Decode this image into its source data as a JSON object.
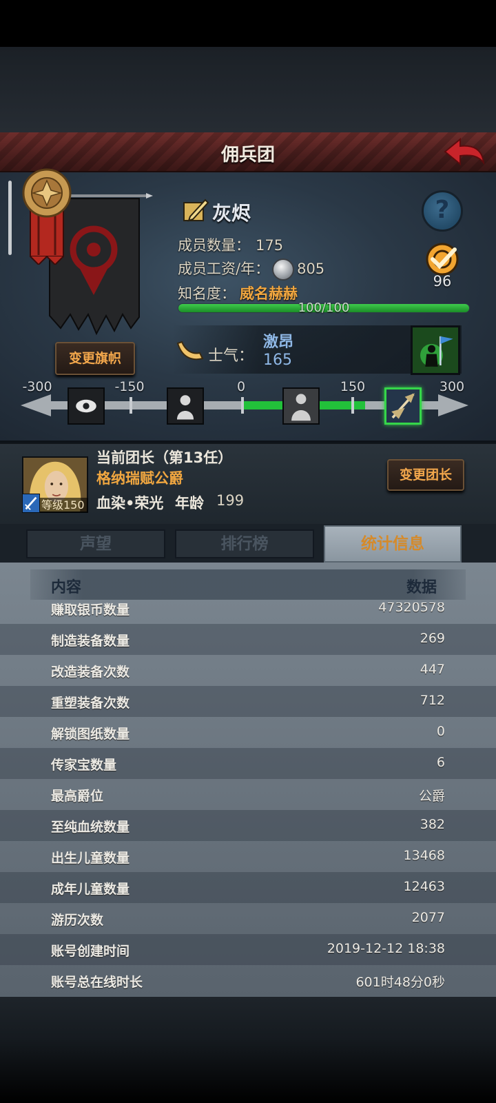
{
  "header": {
    "title": "佣兵团"
  },
  "guild": {
    "name": "灰烬",
    "members_label": "成员数量：",
    "members_value": "175",
    "wage_label": "成员工资/年：",
    "wage_value": "805",
    "fame_label": "知名度：",
    "fame_value": "威名赫赫",
    "fame_progress_text": "100/100",
    "fame_progress": 1.0,
    "achievement_count": "96",
    "change_flag_label": "变更旗帜"
  },
  "morale": {
    "label": "士气：",
    "state": "激昂",
    "value": "165",
    "scale_ticks": [
      "-300",
      "-150",
      "0",
      "150",
      "300"
    ]
  },
  "leader": {
    "title": "当前团长（第13任）",
    "name": "格纳瑞赋公爵",
    "trait": "血染•荣光",
    "age_label": "年龄",
    "age": "199",
    "level_text": "等级150",
    "change_leader_label": "变更团长"
  },
  "tabs": [
    {
      "label": "声望"
    },
    {
      "label": "排行榜"
    },
    {
      "label": "统计信息"
    }
  ],
  "stats": {
    "header_left": "内容",
    "header_right": "数据",
    "rows": [
      {
        "key": "赚取银币数量",
        "value": "47320578"
      },
      {
        "key": "制造装备数量",
        "value": "269"
      },
      {
        "key": "改造装备次数",
        "value": "447"
      },
      {
        "key": "重塑装备次数",
        "value": "712"
      },
      {
        "key": "解锁图纸数量",
        "value": "0"
      },
      {
        "key": "传家宝数量",
        "value": "6"
      },
      {
        "key": "最高爵位",
        "value": "公爵"
      },
      {
        "key": "至纯血统数量",
        "value": "382"
      },
      {
        "key": "出生儿童数量",
        "value": "13468"
      },
      {
        "key": "成年儿童数量",
        "value": "12463"
      },
      {
        "key": "游历次数",
        "value": "2077"
      },
      {
        "key": "账号创建时间",
        "value": "2019-12-12 18:38"
      },
      {
        "key": "账号总在线时长",
        "value": "601时48分0秒"
      }
    ]
  },
  "colors": {
    "accent_orange": "#f0a640",
    "morale_blue": "#8fb8e6",
    "progress_green": "#22c13a",
    "header_red": "#6f2e2c"
  }
}
